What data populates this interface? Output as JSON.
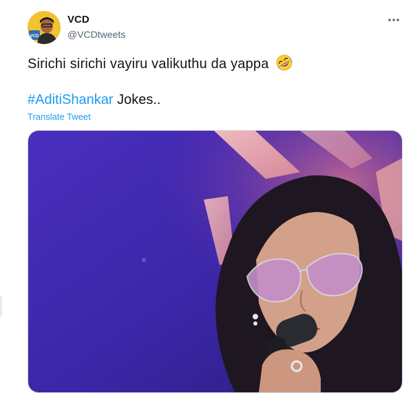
{
  "tweet": {
    "author": {
      "display_name": "VCD",
      "handle": "@VCDtweets",
      "avatar_badge": "VCD"
    },
    "text_line1": "Sirichi sirichi vayiru valikuthu da yappa",
    "emoji": "rolling-on-floor-laughing",
    "hashtag": "#AditiShankar",
    "text_line2_suffix": " Jokes..",
    "translate_label": "Translate Tweet",
    "media": {
      "kind": "video-frame",
      "description_colors": {
        "background": "#3b2ab0",
        "stage_light": "#e6a4a6",
        "hair": "#1e1620"
      }
    }
  },
  "colors": {
    "link": "#1d9bf0",
    "secondary_text": "#536471",
    "avatar_bg": "#f2c230"
  },
  "icons": {
    "more": "more-horizontal-icon"
  }
}
